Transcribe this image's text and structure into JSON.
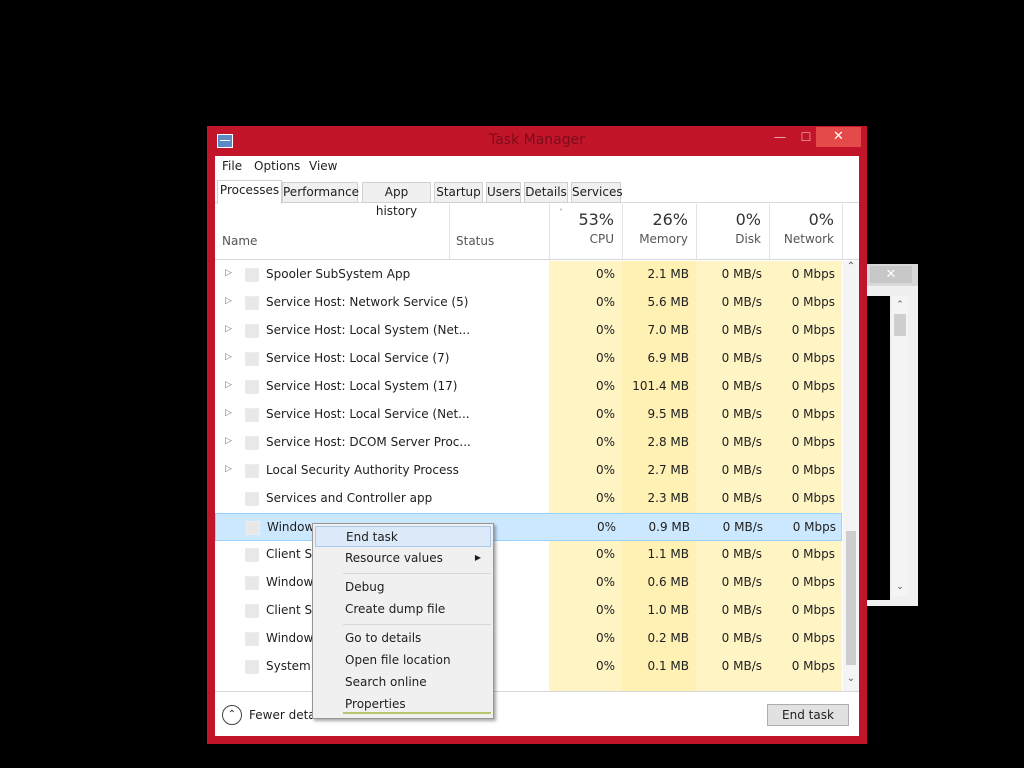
{
  "window": {
    "title": "Task Manager",
    "min_glyph": "—",
    "max_glyph": "☐",
    "close_glyph": "✕"
  },
  "menubar": [
    "File",
    "Options",
    "View"
  ],
  "tabs": [
    "Processes",
    "Performance",
    "App history",
    "Startup",
    "Users",
    "Details",
    "Services"
  ],
  "active_tab": "Processes",
  "columns": {
    "name": "Name",
    "status": "Status",
    "cpu": {
      "pct": "53%",
      "label": "CPU"
    },
    "memory": {
      "pct": "26%",
      "label": "Memory"
    },
    "disk": {
      "pct": "0%",
      "label": "Disk"
    },
    "network": {
      "pct": "0%",
      "label": "Network"
    }
  },
  "rows": [
    {
      "name": "Spooler SubSystem App",
      "expandable": true,
      "cpu": "0%",
      "mem": "2.1 MB",
      "disk": "0 MB/s",
      "net": "0 Mbps"
    },
    {
      "name": "Service Host: Network Service (5)",
      "expandable": true,
      "cpu": "0%",
      "mem": "5.6 MB",
      "disk": "0 MB/s",
      "net": "0 Mbps"
    },
    {
      "name": "Service Host: Local System (Net...",
      "expandable": true,
      "cpu": "0%",
      "mem": "7.0 MB",
      "disk": "0 MB/s",
      "net": "0 Mbps"
    },
    {
      "name": "Service Host: Local Service (7)",
      "expandable": true,
      "cpu": "0%",
      "mem": "6.9 MB",
      "disk": "0 MB/s",
      "net": "0 Mbps"
    },
    {
      "name": "Service Host: Local System (17)",
      "expandable": true,
      "cpu": "0%",
      "mem": "101.4 MB",
      "disk": "0 MB/s",
      "net": "0 Mbps"
    },
    {
      "name": "Service Host: Local Service (Net...",
      "expandable": true,
      "cpu": "0%",
      "mem": "9.5 MB",
      "disk": "0 MB/s",
      "net": "0 Mbps"
    },
    {
      "name": "Service Host: DCOM Server Proc...",
      "expandable": true,
      "cpu": "0%",
      "mem": "2.8 MB",
      "disk": "0 MB/s",
      "net": "0 Mbps"
    },
    {
      "name": "Local Security Authority Process",
      "expandable": true,
      "cpu": "0%",
      "mem": "2.7 MB",
      "disk": "0 MB/s",
      "net": "0 Mbps"
    },
    {
      "name": "Services and Controller app",
      "expandable": false,
      "cpu": "0%",
      "mem": "2.3 MB",
      "disk": "0 MB/s",
      "net": "0 Mbps"
    },
    {
      "name": "Window",
      "expandable": false,
      "selected": true,
      "cpu": "0%",
      "mem": "0.9 MB",
      "disk": "0 MB/s",
      "net": "0 Mbps"
    },
    {
      "name": "Client Se",
      "expandable": false,
      "cpu": "0%",
      "mem": "1.1 MB",
      "disk": "0 MB/s",
      "net": "0 Mbps"
    },
    {
      "name": "Window",
      "expandable": false,
      "cpu": "0%",
      "mem": "0.6 MB",
      "disk": "0 MB/s",
      "net": "0 Mbps"
    },
    {
      "name": "Client Se",
      "expandable": false,
      "cpu": "0%",
      "mem": "1.0 MB",
      "disk": "0 MB/s",
      "net": "0 Mbps"
    },
    {
      "name": "Window",
      "expandable": false,
      "cpu": "0%",
      "mem": "0.2 MB",
      "disk": "0 MB/s",
      "net": "0 Mbps"
    },
    {
      "name": "System",
      "expandable": false,
      "cpu": "0%",
      "mem": "0.1 MB",
      "disk": "0 MB/s",
      "net": "0 Mbps"
    }
  ],
  "footer": {
    "fewer_details": "Fewer detai",
    "end_task": "End task"
  },
  "context_menu": {
    "groups": [
      [
        {
          "label": "End task",
          "highlighted": true
        },
        {
          "label": "Resource values",
          "submenu": true
        }
      ],
      [
        {
          "label": "Debug"
        },
        {
          "label": "Create dump file"
        }
      ],
      [
        {
          "label": "Go to details"
        },
        {
          "label": "Open file location"
        },
        {
          "label": "Search online"
        },
        {
          "label": "Properties"
        }
      ]
    ]
  },
  "icons": {
    "expand": "▷",
    "sort_caret": "˅",
    "fewer": "⌃",
    "scroll_up": "⌃",
    "scroll_down": "⌄",
    "submenu": "▶"
  },
  "colors": {
    "window_frame": "#c2152a",
    "close_button": "#e54a4a",
    "selected_row": "#cce8ff",
    "cpu_heat": "#fff4c4"
  }
}
